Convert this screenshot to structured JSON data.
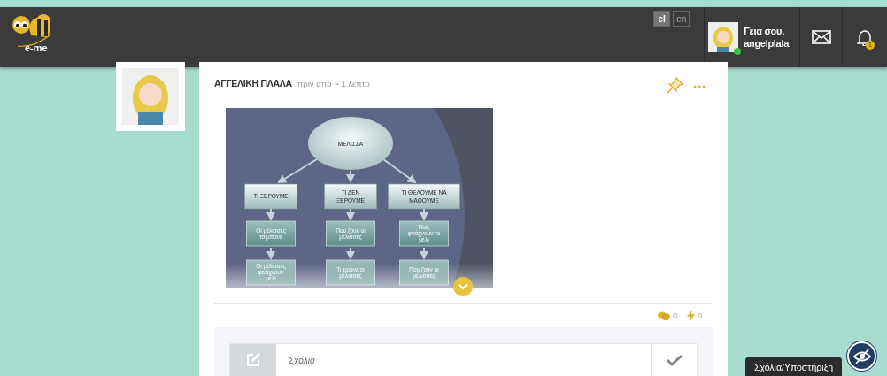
{
  "header": {
    "logo": {
      "text": "e-me"
    },
    "languages": [
      {
        "label": "el",
        "selected": true
      },
      {
        "label": "en",
        "selected": false
      }
    ],
    "user": {
      "greeting": "Γεια σου,",
      "username": "angelplala",
      "online": true
    },
    "notifications": {
      "badge": "1"
    }
  },
  "post": {
    "author": "ΑΓΓΕΛΙΚΗ ΠΛΑΛΑ",
    "time": "πριν από ~ 1 λεπτό",
    "diagram": {
      "root": "ΜΕΛΙΣΣΑ",
      "columns": [
        {
          "heading": [
            "ΤΙ ΞΕΡΟΥΜΕ"
          ],
          "items": [
            [
              "Οι μέλισσες",
              "τσιμπάνε"
            ],
            [
              "Οι μέλισσες",
              "φτιάχνουν",
              "μέλι"
            ]
          ]
        },
        {
          "heading": [
            "ΤΙ ΔΕΝ",
            "ΞΕΡΟΥΜΕ"
          ],
          "items": [
            [
              "Που ζουν οι",
              "μέλισσες"
            ],
            [
              "Τι τρώνε οι",
              "μέλισσες"
            ]
          ]
        },
        {
          "heading": [
            "ΤΙ ΘΕΛΟΥΜΕ ΝΑ",
            "ΜΑΘΟΥΜΕ"
          ],
          "items": [
            [
              "Πως",
              "φτιάχνουν το",
              "μέλι"
            ],
            [
              "Που ζουν οι",
              "μέλισσες"
            ]
          ]
        }
      ]
    },
    "stats": {
      "comments": "0",
      "reactions": "0"
    },
    "comment": {
      "placeholder": "Σχόλιο"
    }
  },
  "feedback_tab": {
    "label": "Σχόλια/Υποστήριξη"
  }
}
